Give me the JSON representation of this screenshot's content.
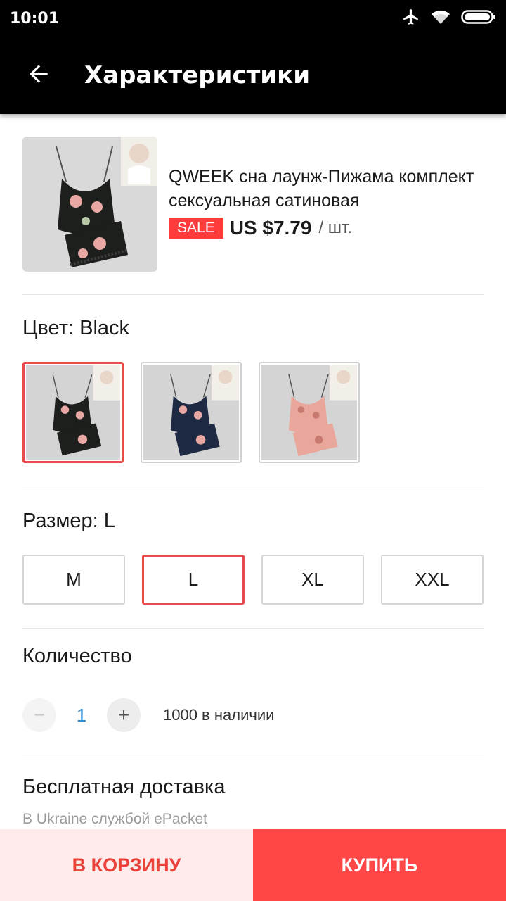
{
  "status_bar": {
    "time": "10:01",
    "icons": [
      "airplane-mode-icon",
      "wifi-icon",
      "battery-icon"
    ]
  },
  "header": {
    "title": "Характеристики",
    "back_icon": "arrow-left-icon"
  },
  "product": {
    "title": "QWEEK сна лаунж-Пижама комплект сексуальная сатиновая",
    "badge": "SALE",
    "price": "US $7.79",
    "unit": "/ шт."
  },
  "color": {
    "label": "Цвет: Black",
    "options": [
      {
        "name": "Black",
        "selected": true,
        "fabric": "#1d1f1c"
      },
      {
        "name": "Navy",
        "selected": false,
        "fabric": "#1e2a44"
      },
      {
        "name": "Pink",
        "selected": false,
        "fabric": "#e9a79c"
      }
    ]
  },
  "size": {
    "label": "Размер: L",
    "options": [
      {
        "label": "M",
        "selected": false
      },
      {
        "label": "L",
        "selected": true
      },
      {
        "label": "XL",
        "selected": false
      },
      {
        "label": "XXL",
        "selected": false
      }
    ]
  },
  "quantity": {
    "label": "Количество",
    "minus": "−",
    "value": "1",
    "plus": "+",
    "stock": "1000 в наличии"
  },
  "shipping": {
    "title": "Бесплатная доставка",
    "subtitle": "В Ukraine службой ePacket"
  },
  "actions": {
    "add_to_cart": "В КОРЗИНУ",
    "buy": "КУПИТЬ"
  },
  "colors": {
    "accent": "#ff4747",
    "selected_border": "#e94a4a",
    "quantity_value": "#2a8fd6"
  }
}
